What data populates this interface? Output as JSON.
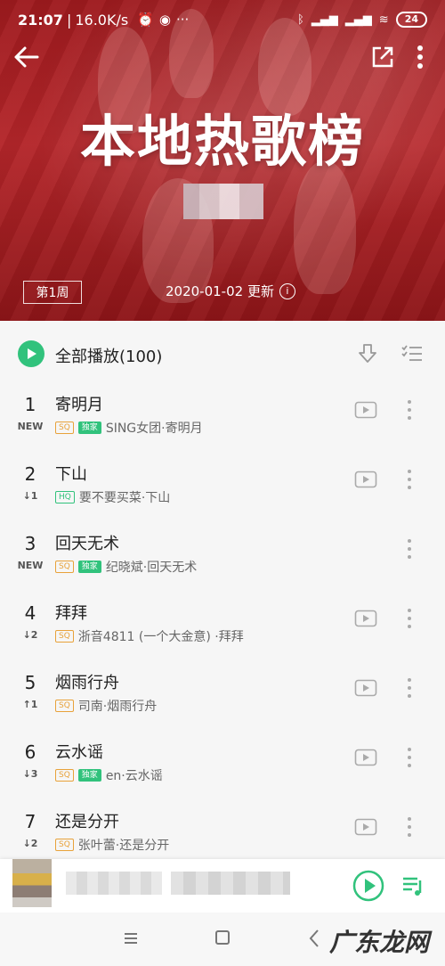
{
  "status_bar": {
    "time": "21:07",
    "speed": "16.0K/s",
    "dots": "···",
    "battery": "24"
  },
  "header": {
    "title": "本地热歌榜",
    "week": "第1周",
    "update_text": "2020-01-02 更新",
    "info_glyph": "i"
  },
  "toolbar": {
    "play_all_label": "全部播放(100)"
  },
  "songs": [
    {
      "rank": "1",
      "trend": "NEW",
      "title": "寄明月",
      "tags": [
        "SQ",
        "独家"
      ],
      "artist": "SING女团·寄明月",
      "has_mv": true
    },
    {
      "rank": "2",
      "trend": "↓1",
      "title": "下山",
      "tags": [
        "HQ"
      ],
      "artist": "要不要买菜·下山",
      "has_mv": true
    },
    {
      "rank": "3",
      "trend": "NEW",
      "title": "回天无术",
      "tags": [
        "SQ",
        "独家"
      ],
      "artist": "纪晓斌·回天无术",
      "has_mv": false
    },
    {
      "rank": "4",
      "trend": "↓2",
      "title": "拜拜",
      "tags": [
        "SQ"
      ],
      "artist": "浙音4811 (一个大金意) ·拜拜",
      "has_mv": true
    },
    {
      "rank": "5",
      "trend": "↑1",
      "title": "烟雨行舟",
      "tags": [
        "SQ"
      ],
      "artist": "司南·烟雨行舟",
      "has_mv": true
    },
    {
      "rank": "6",
      "trend": "↓3",
      "title": "云水谣",
      "tags": [
        "SQ",
        "独家"
      ],
      "artist": "en·云水谣",
      "has_mv": true
    },
    {
      "rank": "7",
      "trend": "↓2",
      "title": "还是分开",
      "tags": [
        "SQ"
      ],
      "artist": "张叶蕾·还是分开",
      "has_mv": true
    }
  ],
  "watermark": "广东龙网",
  "colors": {
    "accent": "#31c27c",
    "header_red": "#b4262a",
    "sq_tag": "#e8a23a"
  }
}
